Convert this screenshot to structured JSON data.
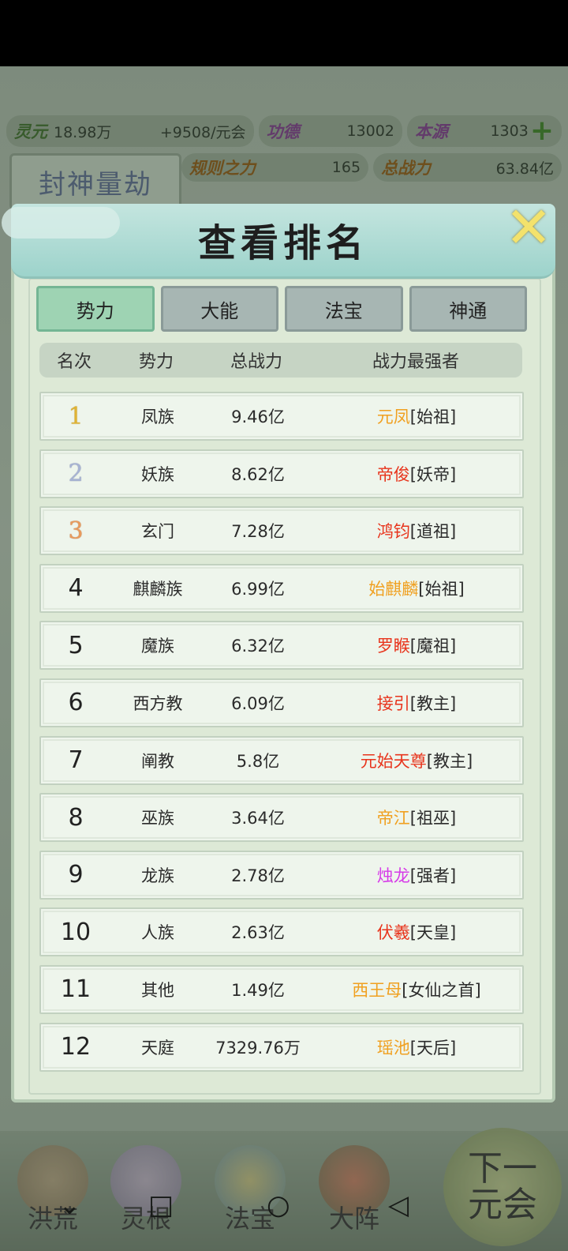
{
  "topbar": {
    "lingyuan_label": "灵元",
    "lingyuan_value": "18.98万",
    "rate": "+9508/元会",
    "gongde_label": "功德",
    "gongde_value": "13002",
    "benyuan_label": "本源",
    "benyuan_value": "1303",
    "guize_label": "规则之力",
    "guize_value": "165",
    "zongzhanli_label": "总战力",
    "zongzhanli_value": "63.84亿",
    "era_title": "封神量劫"
  },
  "modal": {
    "title": "查看排名",
    "tabs": [
      {
        "label": "势力",
        "active": true
      },
      {
        "label": "大能",
        "active": false
      },
      {
        "label": "法宝",
        "active": false
      },
      {
        "label": "神通",
        "active": false
      }
    ],
    "columns": [
      "名次",
      "势力",
      "总战力",
      "战力最强者"
    ],
    "rows": [
      {
        "rank": "1",
        "faction": "凤族",
        "power": "9.46亿",
        "leader_name": "元凤",
        "leader_title": "[始祖]",
        "leader_color": "#f0a020"
      },
      {
        "rank": "2",
        "faction": "妖族",
        "power": "8.62亿",
        "leader_name": "帝俊",
        "leader_title": "[妖帝]",
        "leader_color": "#e8341c"
      },
      {
        "rank": "3",
        "faction": "玄门",
        "power": "7.28亿",
        "leader_name": "鸿钧",
        "leader_title": "[道祖]",
        "leader_color": "#e8341c"
      },
      {
        "rank": "4",
        "faction": "麒麟族",
        "power": "6.99亿",
        "leader_name": "始麒麟",
        "leader_title": "[始祖]",
        "leader_color": "#f0a020"
      },
      {
        "rank": "5",
        "faction": "魔族",
        "power": "6.32亿",
        "leader_name": "罗睺",
        "leader_title": "[魔祖]",
        "leader_color": "#e8341c"
      },
      {
        "rank": "6",
        "faction": "西方教",
        "power": "6.09亿",
        "leader_name": "接引",
        "leader_title": "[教主]",
        "leader_color": "#e8341c"
      },
      {
        "rank": "7",
        "faction": "阐教",
        "power": "5.8亿",
        "leader_name": "元始天尊",
        "leader_title": "[教主]",
        "leader_color": "#e8341c"
      },
      {
        "rank": "8",
        "faction": "巫族",
        "power": "3.64亿",
        "leader_name": "帝江",
        "leader_title": "[祖巫]",
        "leader_color": "#f0a020"
      },
      {
        "rank": "9",
        "faction": "龙族",
        "power": "2.78亿",
        "leader_name": "烛龙",
        "leader_title": "[强者]",
        "leader_color": "#d63ae8"
      },
      {
        "rank": "10",
        "faction": "人族",
        "power": "2.63亿",
        "leader_name": "伏羲",
        "leader_title": "[天皇]",
        "leader_color": "#e8341c"
      },
      {
        "rank": "11",
        "faction": "其他",
        "power": "1.49亿",
        "leader_name": "西王母",
        "leader_title": "[女仙之首]",
        "leader_color": "#f0a020"
      },
      {
        "rank": "12",
        "faction": "天庭",
        "power": "7329.76万",
        "leader_name": "瑶池",
        "leader_title": "[天后]",
        "leader_color": "#f0a020"
      }
    ]
  },
  "bottom_nav": [
    {
      "label": "洪荒"
    },
    {
      "label": "灵根"
    },
    {
      "label": "法宝"
    },
    {
      "label": "大阵"
    }
  ],
  "next_button": {
    "line1": "下一",
    "line2": "元会"
  },
  "colors": {
    "tab_active": "#9ed3b3",
    "tab_inactive": "#a7b6b3",
    "header_teal": "#9dd3cb",
    "close_yellow": "#f3e26c"
  }
}
